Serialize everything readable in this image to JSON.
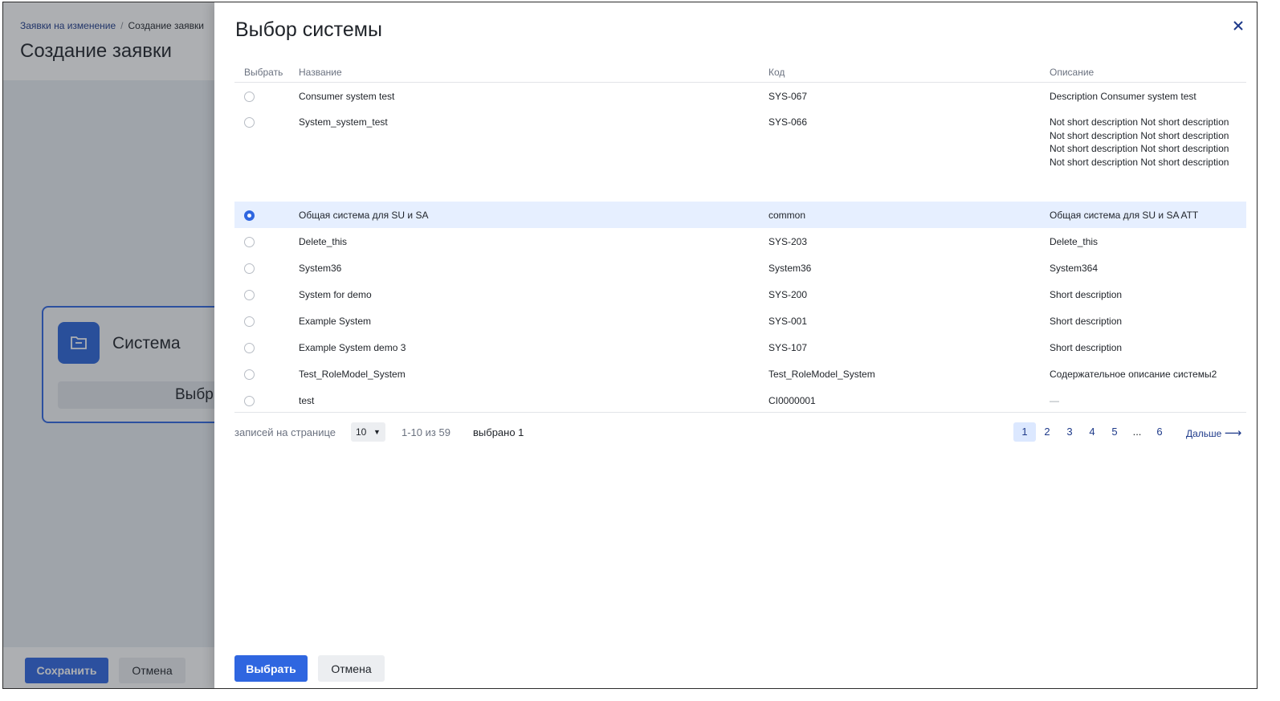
{
  "page": {
    "breadcrumb": {
      "link": "Заявки на изменение",
      "separator": "/",
      "current": "Создание заявки"
    },
    "title": "Создание заявки",
    "card": {
      "title": "Система",
      "button_label": "Выбр"
    },
    "zoom": {
      "in": "+",
      "out": "−",
      "fit": "⛶"
    },
    "footer": {
      "save_label": "Сохранить",
      "cancel_label": "Отмена"
    }
  },
  "drawer": {
    "title": "Выбор системы",
    "columns": {
      "select": "Выбрать",
      "name": "Название",
      "code": "Код",
      "description": "Описание"
    },
    "rows": [
      {
        "name": "Consumer system test",
        "code": "SYS-067",
        "description": "Description Consumer system test",
        "selected": false
      },
      {
        "name": "System_system_test",
        "code": "SYS-066",
        "description": "Not short description Not short description Not short description Not short description Not short description Not short description Not short description Not short description",
        "selected": false
      },
      {
        "name": "Общая система для SU и SA",
        "code": "common",
        "description": "Общая система для SU и SA ATT",
        "selected": true
      },
      {
        "name": "Delete_this",
        "code": "SYS-203",
        "description": "Delete_this",
        "selected": false
      },
      {
        "name": "System36",
        "code": "System36",
        "description": "System364",
        "selected": false
      },
      {
        "name": "System for demo",
        "code": "SYS-200",
        "description": "Short description",
        "selected": false
      },
      {
        "name": "Example System",
        "code": "SYS-001",
        "description": "Short description",
        "selected": false
      },
      {
        "name": "Example System demo 3",
        "code": "SYS-107",
        "description": "Short description",
        "selected": false
      },
      {
        "name": "Test_RoleModel_System",
        "code": "Test_RoleModel_System",
        "description": "Содержательное описание системы2",
        "selected": false
      },
      {
        "name": "test",
        "code": "CI0000001",
        "description": "—",
        "selected": false
      }
    ],
    "pagination": {
      "per_page_label": "записей на странице",
      "per_page_value": "10",
      "range": "1-10 из 59",
      "selected_count": "выбрано 1",
      "pages": [
        "1",
        "2",
        "3",
        "4",
        "5",
        "...",
        "6"
      ],
      "current_page": "1",
      "next_label": "Дальше"
    },
    "buttons": {
      "select_label": "Выбрать",
      "cancel_label": "Отмена"
    }
  },
  "colors": {
    "accent": "#2f66e0",
    "selected_row": "#e6efff",
    "link": "#1e3a8a"
  }
}
